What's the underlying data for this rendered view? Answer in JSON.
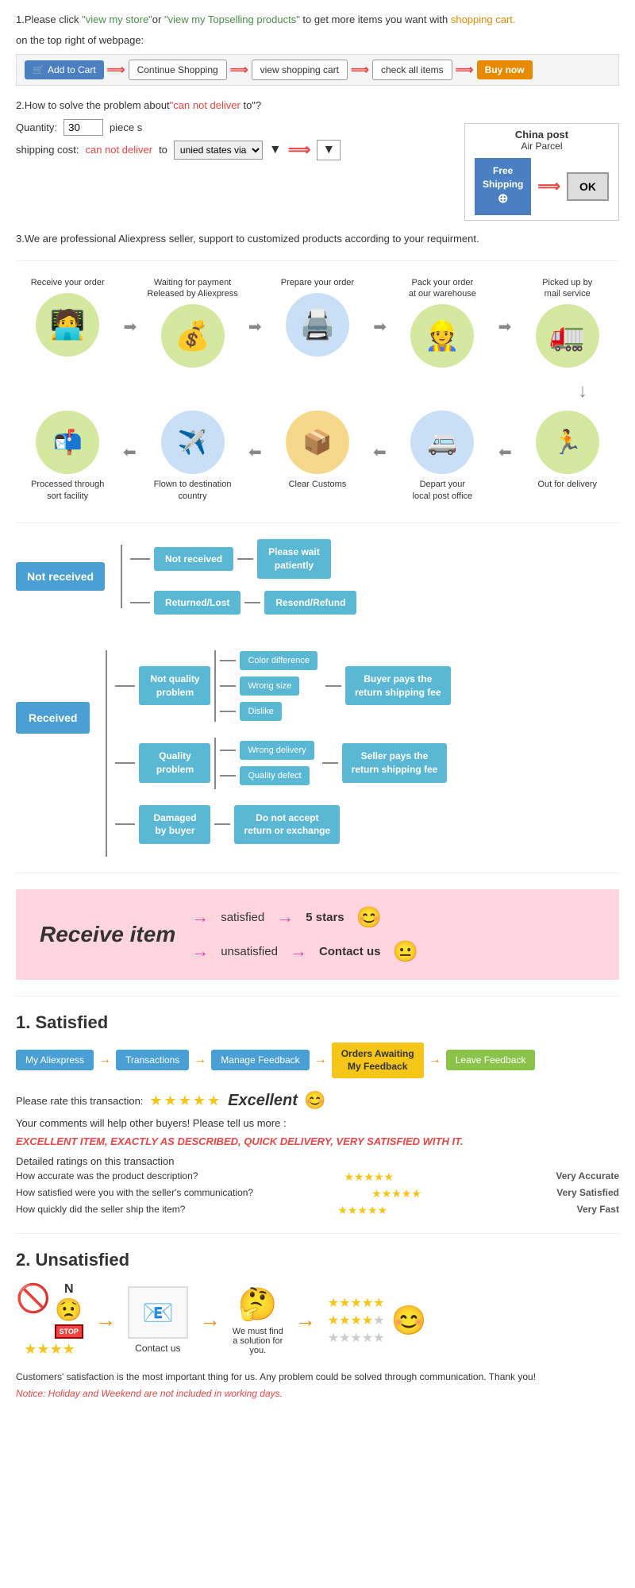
{
  "page": {
    "section1": {
      "text1": "1.Please click ",
      "link1": "\"view my store\"",
      "text2": "or ",
      "link2": "\"view my Topselling products\"",
      "text3": " to get more items you want with",
      "text4": "shopping cart.",
      "text5": "on the top right of webpage:",
      "cart_buttons": [
        {
          "label": "Add to Cart",
          "type": "cart"
        },
        {
          "label": "Continue Shopping",
          "type": "white"
        },
        {
          "label": "view shopping cart",
          "type": "white"
        },
        {
          "label": "check all items",
          "type": "white"
        },
        {
          "label": "Buy now",
          "type": "orange"
        }
      ]
    },
    "section2": {
      "text1": "2.How to solve the problem about",
      "highlight1": "can not deliver",
      "text2": " to",
      "question": "?",
      "qty_label": "Quantity:",
      "qty_value": "30",
      "qty_suffix": "piece s",
      "shipping_label": "shipping cost:",
      "ship_highlight": "can not deliver",
      "ship_text": " to ",
      "ship_select": "unied states via",
      "china_post_title": "China post",
      "china_post_subtitle": "Air Parcel",
      "free_shipping": "Free\nShipping",
      "ok_label": "OK"
    },
    "section3": {
      "text": "3.We are professional Aliexpress seller, support to customized products according to your requirment."
    },
    "flow": {
      "row1": [
        {
          "label": "Receive your order",
          "icon": "🧑‍💻"
        },
        {
          "label": "Waiting for payment\nReleased by Aliexpress",
          "icon": "💰"
        },
        {
          "label": "Prepare your order",
          "icon": "🖨️"
        },
        {
          "label": "Pack your order\nat our warehouse",
          "icon": "👷"
        },
        {
          "label": "Picked up by\nmail service",
          "icon": "🚛"
        }
      ],
      "row2": [
        {
          "label": "Out for delivery",
          "icon": "🏃"
        },
        {
          "label": "Depart your\nlocal post office",
          "icon": "🚐"
        },
        {
          "label": "Clear Customs",
          "icon": "📦"
        },
        {
          "label": "Flown to destination\ncountry",
          "icon": "✈️"
        },
        {
          "label": "Processed through\nsort facility",
          "icon": "📬"
        }
      ]
    },
    "decision_tree": {
      "not_received": {
        "main": "Not received",
        "branches": [
          {
            "label": "Not received",
            "result": "Please wait\npatiently"
          },
          {
            "label": "Returned/Lost",
            "result": "Resend/Refund"
          }
        ]
      },
      "received": {
        "main": "Received",
        "branches": [
          {
            "label": "Not quality\nproblem",
            "sub": [
              "Color difference",
              "Wrong size",
              "Dislike"
            ],
            "result": "Buyer pays the\nreturn shipping fee"
          },
          {
            "label": "Quality\nproblem",
            "sub": [
              "Wrong delivery",
              "Quality defect"
            ],
            "result": "Seller pays the\nreturn shipping fee"
          },
          {
            "label": "Damaged\nby buyer",
            "result": "Do not accept\nreturn or exchange"
          }
        ]
      }
    },
    "pink_section": {
      "title": "Receive item",
      "satisfied": "satisfied",
      "unsatisfied": "unsatisfied",
      "stars": "5 stars",
      "contact": "Contact us",
      "emoji_happy": "😊",
      "emoji_neutral": "😐"
    },
    "satisfied": {
      "heading": "1. Satisfied",
      "flow": [
        "My Aliexpress",
        "Transactions",
        "Manage Feedback",
        "Orders Awaiting\nMy Feedback",
        "Leave Feedback"
      ],
      "rate_text": "Please rate this transaction:",
      "stars": "★★★★★",
      "excellent": "Excellent",
      "emoji": "😊",
      "comments": "Your comments will help other buyers! Please tell us more :",
      "example": "EXCELLENT ITEM, EXACTLY AS DESCRIBED, QUICK DELIVERY, VERY SATISFIED WITH IT.",
      "detail_heading": "Detailed ratings on this transaction",
      "details": [
        {
          "label": "How accurate was the product description?",
          "value": "Very Accurate"
        },
        {
          "label": "How satisfied were you with the seller's communication?",
          "value": "Very Satisfied"
        },
        {
          "label": "How quickly did the seller ship the item?",
          "value": "Very Fast"
        }
      ]
    },
    "unsatisfied": {
      "heading": "2. Unsatisfied",
      "steps": [
        {
          "type": "icons",
          "icons": [
            "🚫",
            "N😟",
            "🛑"
          ]
        },
        {
          "type": "arrow"
        },
        {
          "type": "email",
          "icon": "📧",
          "label": "Contact us"
        },
        {
          "type": "arrow"
        },
        {
          "type": "question",
          "icon": "❓",
          "label": "We must find\na solution for\nyou."
        },
        {
          "type": "arrow"
        },
        {
          "type": "stars_group"
        }
      ],
      "notice": "Customers' satisfaction is the most important thing for us. Any problem could be solved through communication. Thank you!",
      "notice2": "Notice: Holiday and Weekend are not included in working days."
    }
  }
}
